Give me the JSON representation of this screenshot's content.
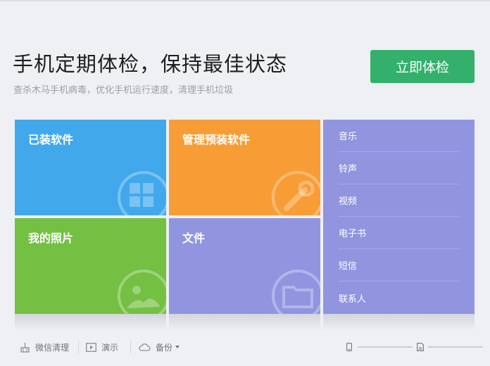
{
  "header": {
    "title": "手机定期体检，保持最佳状态",
    "subtitle": "查杀木马手机病毒，优化手机运行速度，清理手机垃圾",
    "check_button": "立即体检"
  },
  "tiles": {
    "installed_apps": "已装软件",
    "preinstalled_apps": "管理预装软件",
    "photos": "我的照片",
    "files": "文件"
  },
  "side_list": [
    "音乐",
    "铃声",
    "视频",
    "电子书",
    "短信",
    "联系人"
  ],
  "bottom_bar": {
    "wechat_clean": "微信清理",
    "demo": "演示",
    "backup": "备份"
  },
  "colors": {
    "accent_green": "#33b16c",
    "tile_blue": "#42a8ec",
    "tile_orange": "#f89d35",
    "tile_green": "#74c043",
    "tile_purple": "#9195e0"
  }
}
